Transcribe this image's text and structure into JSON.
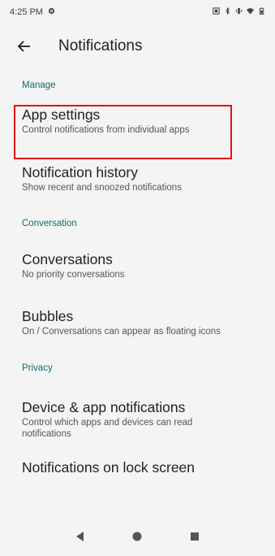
{
  "status_bar": {
    "time": "4:25 PM",
    "icons": [
      "settings-gear-icon",
      "screenshot-icon",
      "bluetooth-icon",
      "vibrate-icon",
      "wifi-icon",
      "battery-icon"
    ]
  },
  "app_bar": {
    "back_icon": "arrow-back-icon",
    "title": "Notifications"
  },
  "sections": [
    {
      "header": "Manage",
      "items": [
        {
          "title": "App settings",
          "summary": "Control notifications from individual apps"
        },
        {
          "title": "Notification history",
          "summary": "Show recent and snoozed notifications"
        }
      ]
    },
    {
      "header": "Conversation",
      "items": [
        {
          "title": "Conversations",
          "summary": "No priority conversations"
        },
        {
          "title": "Bubbles",
          "summary": "On / Conversations can appear as floating icons"
        }
      ]
    },
    {
      "header": "Privacy",
      "items": [
        {
          "title": "Device & app notifications",
          "summary": "Control which apps and devices can read notifications"
        },
        {
          "title": "Notifications on lock screen",
          "summary": ""
        }
      ]
    }
  ],
  "nav_bar": {
    "icons": [
      "back-triangle-icon",
      "home-circle-icon",
      "recents-square-icon"
    ]
  },
  "colors": {
    "accent": "#116b6b",
    "highlight": "#e11414",
    "background": "#f4f4f4"
  }
}
